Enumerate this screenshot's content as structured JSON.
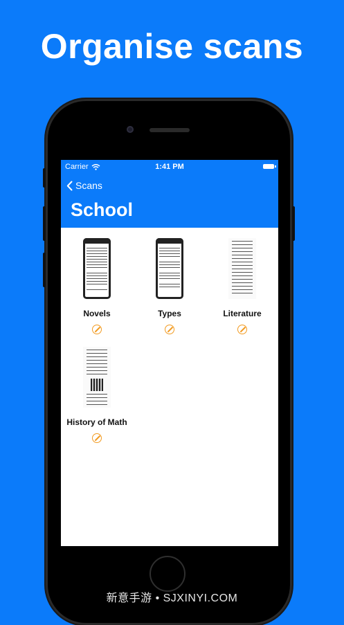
{
  "headline": "Organise scans",
  "status": {
    "carrier": "Carrier",
    "time": "1:41 PM"
  },
  "nav": {
    "back_label": "Scans",
    "title": "School"
  },
  "items": [
    {
      "label": "Novels"
    },
    {
      "label": "Types"
    },
    {
      "label": "Literature"
    },
    {
      "label": "History of Math"
    }
  ],
  "watermark": "新意手游 • SJXINYI.COM",
  "colors": {
    "background": "#0b7bfa",
    "accent": "#f29a1f"
  }
}
